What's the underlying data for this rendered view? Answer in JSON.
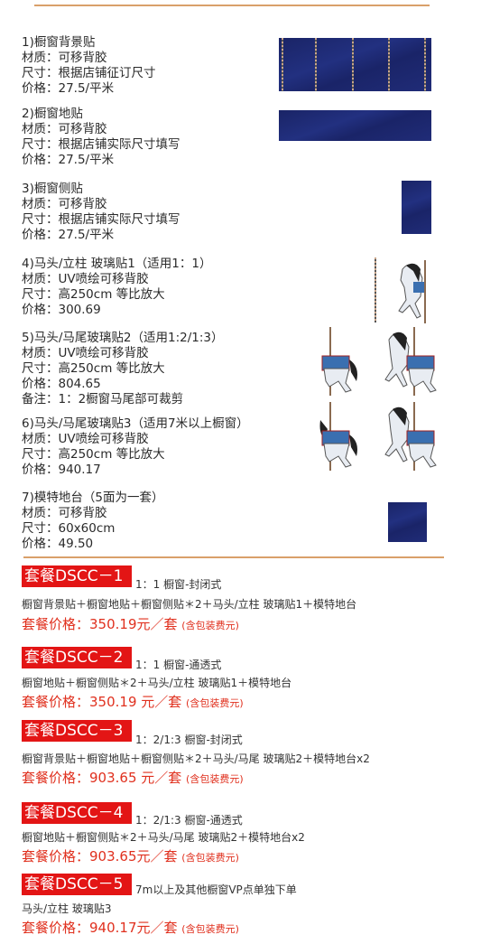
{
  "products": [
    {
      "title": "1)橱窗背景贴",
      "lines": [
        "材质：可移背胶",
        "尺寸：根据店铺征订尺寸",
        "价格：27.5/平米"
      ]
    },
    {
      "title": "2)橱窗地贴",
      "lines": [
        "材质：可移背胶",
        "尺寸：根据店铺实际尺寸填写",
        "价格：27.5/平米"
      ]
    },
    {
      "title": "3)橱窗侧贴",
      "lines": [
        "材质：可移背胶",
        "尺寸：根据店铺实际尺寸填写",
        "价格：27.5/平米"
      ]
    },
    {
      "title": "4)马头/立柱 玻璃贴1（适用1：1）",
      "lines": [
        "材质：UV喷绘可移背胶",
        "尺寸：高250cm 等比放大",
        "价格：300.69"
      ]
    },
    {
      "title": "5)马头/马尾玻璃贴2（适用1:2/1:3）",
      "lines": [
        "材质：UV喷绘可移背胶",
        "尺寸：高250cm 等比放大",
        "价格：804.65",
        "备注：1：2橱窗马尾部可裁剪"
      ]
    },
    {
      "title": "6)马头/马尾玻璃贴3（适用7米以上橱窗）",
      "lines": [
        "材质：UV喷绘可移背胶",
        "尺寸：高250cm 等比放大",
        "价格：940.17"
      ]
    },
    {
      "title": "7)模特地台（5面为一套）",
      "lines": [
        "材质：可移背胶",
        "尺寸：60x60cm",
        "价格：49.50"
      ]
    }
  ],
  "packages": [
    {
      "name": "套餐DSCC－1",
      "desc": "1：1 橱窗-封闭式",
      "parts": "橱窗背景贴＋橱窗地贴＋橱窗侧贴＊2＋马头/立柱 玻璃贴1＋模特地台",
      "price": "套餐价格：350.19元／套",
      "note": "(含包装费元)"
    },
    {
      "name": "套餐DSCC－2",
      "desc": "1：1 橱窗-通透式",
      "parts": "橱窗地贴＋橱窗侧贴＊2＋马头/立柱 玻璃贴1＋模特地台",
      "price": "套餐价格：350.19 元／套",
      "note": "(含包装费元)"
    },
    {
      "name": "套餐DSCC－3",
      "desc": "1：2/1:3 橱窗-封闭式",
      "parts": "橱窗背景贴＋橱窗地贴＋橱窗侧贴＊2＋马头/马尾 玻璃贴2＋模特地台x2",
      "price": "套餐价格：903.65 元／套",
      "note": "(含包装费元)"
    },
    {
      "name": "套餐DSCC－4",
      "desc": "1：2/1:3 橱窗-通透式",
      "parts": "橱窗地贴＋橱窗侧贴＊2＋马头/马尾 玻璃贴2＋模特地台x2",
      "price": "套餐价格：903.65元／套",
      "note": "(含包装费元)"
    },
    {
      "name": "套餐DSCC－5",
      "desc": "7m以上及其他橱窗VP点单独下单",
      "parts": "马头/立柱 玻璃贴3",
      "price": "套餐价格：940.17元／套",
      "note": "(含包装费元)"
    }
  ],
  "colors": {
    "accent": "#e31515",
    "rule": "#d9a06a",
    "navy": "#1a2466"
  }
}
